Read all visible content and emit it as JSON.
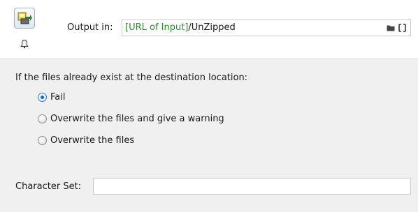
{
  "header": {
    "action_icon": "run-action-icon",
    "bell_icon": "bell-icon",
    "output_label": "Output in:",
    "output_value_token": "[URL of Input]",
    "output_value_path": "/UnZipped",
    "folder_icon": "folder-icon",
    "expand_icon": "expand-icon"
  },
  "options": {
    "question": "If the files already exist at the destination location:",
    "radios": [
      {
        "label": "Fail",
        "checked": true
      },
      {
        "label": "Overwrite the files and give a warning",
        "checked": false
      },
      {
        "label": "Overwrite the files",
        "checked": false
      }
    ],
    "charset_label": "Character Set:",
    "charset_value": ""
  },
  "colors": {
    "variable_token": "#2e8b2e",
    "panel_background": "#f0f0f0",
    "radio_selected": "#1c5fc8"
  }
}
